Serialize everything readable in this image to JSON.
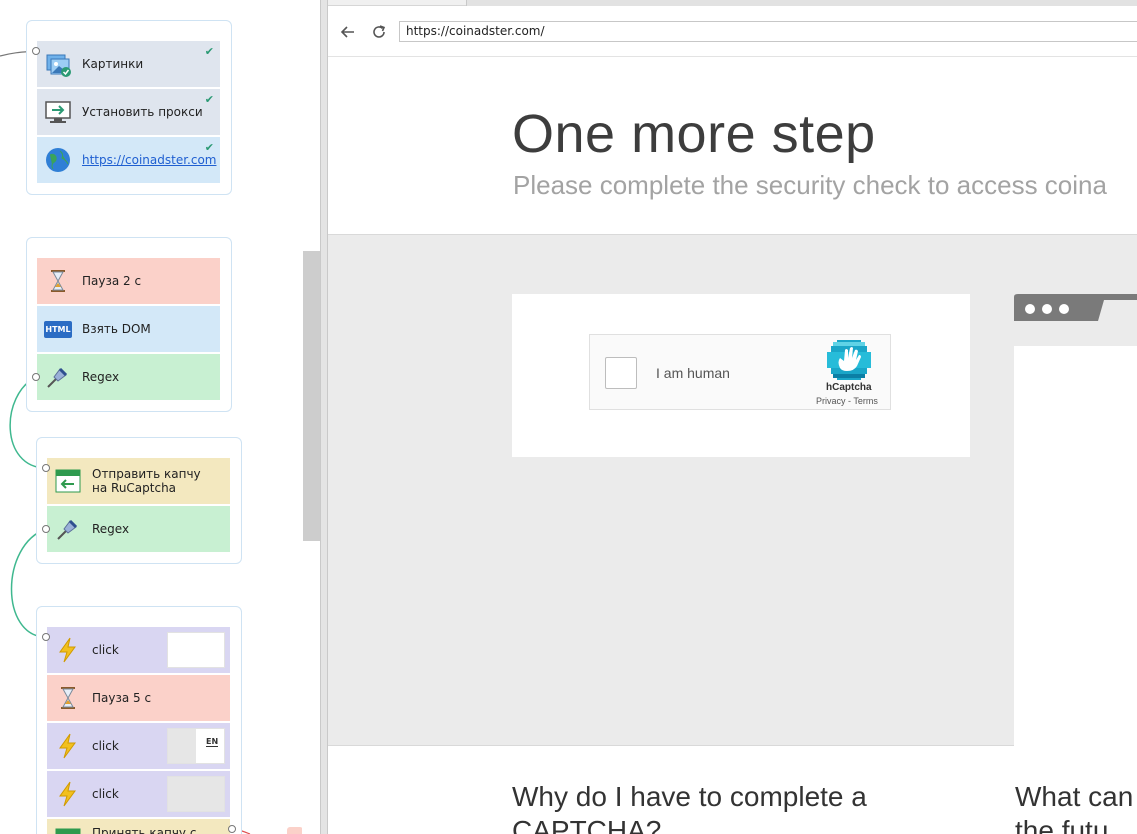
{
  "workflow": {
    "groups": [
      {
        "blocks": [
          {
            "label": "Картинки",
            "icon": "images-icon",
            "color": "#dfe5ee",
            "done": true
          },
          {
            "label": "Установить прокси",
            "icon": "monitor-proxy-icon",
            "color": "#dfe5ee",
            "done": true
          },
          {
            "label": "https://coinadster.com",
            "icon": "globe-icon",
            "color": "#d3e8f8",
            "done": true
          }
        ]
      },
      {
        "blocks": [
          {
            "label": "Пауза 2 с",
            "icon": "hourglass-icon",
            "color": "#fbd1c9"
          },
          {
            "label": "Взять DOM",
            "icon": "html-icon",
            "icon_text": "HTML",
            "color": "#d3e8f8"
          },
          {
            "label": "Regex",
            "icon": "regex-pin-icon",
            "color": "#c8f0d2"
          }
        ]
      },
      {
        "blocks": [
          {
            "label": "Отправить капчу на RuCaptcha",
            "icon": "send-captcha-icon",
            "color": "#f3e8bf"
          },
          {
            "label": "Regex",
            "icon": "regex-pin-icon",
            "color": "#c8f0d2"
          }
        ]
      },
      {
        "blocks": [
          {
            "label": "click",
            "icon": "lightning-icon",
            "color": "#d9d6f2"
          },
          {
            "label": "Пауза 5 с",
            "icon": "hourglass-icon",
            "color": "#fbd1c9"
          },
          {
            "label": "click",
            "icon": "lightning-icon",
            "color": "#d9d6f2",
            "thumb_text": "EN"
          },
          {
            "label": "click",
            "icon": "lightning-icon",
            "color": "#d9d6f2"
          },
          {
            "label": "Принять капчу с",
            "icon": "receive-captcha-icon",
            "color": "#f3e8bf"
          }
        ]
      }
    ],
    "wire_color": "#3fb88f"
  },
  "browser": {
    "url": "https://coinadster.com/",
    "page": {
      "title": "One more step",
      "subtitle": "Please complete the security check to access coina",
      "captcha": {
        "checkbox_label": "I am human",
        "brand": "hCaptcha",
        "privacy": "Privacy",
        "separator": " - ",
        "terms": "Terms"
      },
      "faq": {
        "q1_line1": "Why do I have to complete a",
        "q1_line2": "CAPTCHA?",
        "q2_line1": "What can",
        "q2_line2": "the futu"
      }
    }
  }
}
